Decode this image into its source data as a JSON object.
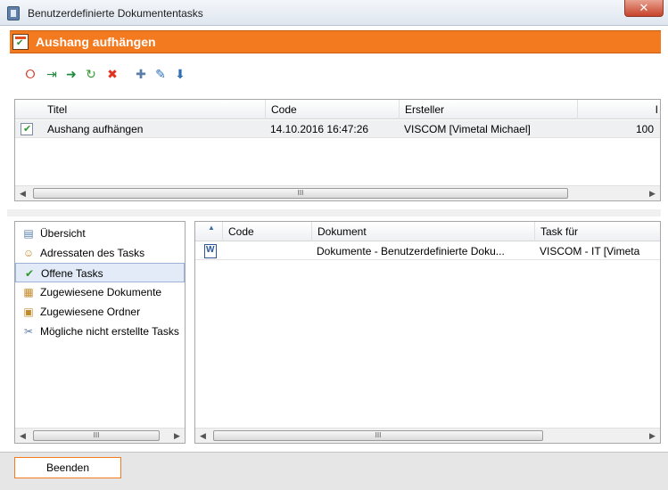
{
  "window": {
    "title": "Benutzerdefinierte Dokumententasks",
    "close_label": "✕"
  },
  "header": {
    "title": "Aushang aufhängen"
  },
  "toolbar": {
    "buttons": [
      {
        "name": "help-icon",
        "glyph": "⭘",
        "color": "#d23b2a"
      },
      {
        "name": "export-excel-icon",
        "glyph": "⇥",
        "color": "#1f8a3c"
      },
      {
        "name": "forward-icon",
        "glyph": "➜",
        "color": "#1f8a3c"
      },
      {
        "name": "refresh-icon",
        "glyph": "↻",
        "color": "#2e9a2e"
      },
      {
        "name": "delete-icon",
        "glyph": "✖",
        "color": "#e0321f"
      },
      {
        "name": "new-document-icon",
        "glyph": "✚",
        "color": "#5b7ea8"
      },
      {
        "name": "edit-icon",
        "glyph": "✎",
        "color": "#2e6fb8"
      },
      {
        "name": "save-icon",
        "glyph": "⬇",
        "color": "#2e6fb8"
      }
    ]
  },
  "task_grid": {
    "columns": [
      "Titel",
      "Code",
      "Ersteller",
      "I"
    ],
    "rows": [
      {
        "title": "Aushang aufhängen",
        "code": "14.10.2016 16:47:26",
        "creator": "VISCOM [Vimetal Michael]",
        "extra": "100"
      }
    ],
    "scroll_thumb": "III"
  },
  "nav": {
    "items": [
      {
        "label": "Übersicht",
        "icon": "overview-icon",
        "glyph": "▤",
        "color": "#5b7ea8"
      },
      {
        "label": "Adressaten des Tasks",
        "icon": "users-icon",
        "glyph": "☺",
        "color": "#c48a2a"
      },
      {
        "label": "Offene Tasks",
        "icon": "task-check-icon",
        "glyph": "✔",
        "color": "#2e9a2e"
      },
      {
        "label": "Zugewiesene Dokumente",
        "icon": "documents-icon",
        "glyph": "▦",
        "color": "#c48a2a"
      },
      {
        "label": "Zugewiesene Ordner",
        "icon": "folder-tree-icon",
        "glyph": "▣",
        "color": "#c48a2a"
      },
      {
        "label": "Mögliche nicht erstellte Tasks",
        "icon": "tools-icon",
        "glyph": "✂",
        "color": "#5b7ea8"
      }
    ],
    "selected_index": 2,
    "scroll_thumb": "III"
  },
  "document_grid": {
    "sort_indicator": "▲",
    "columns": [
      "Code",
      "Dokument",
      "Task für"
    ],
    "rows": [
      {
        "code": "",
        "document": "Dokumente - Benutzerdefinierte Doku...",
        "task_for": "VISCOM - IT [Vimeta"
      }
    ],
    "scroll_thumb": "III"
  },
  "footer": {
    "close_button": "Beenden"
  }
}
